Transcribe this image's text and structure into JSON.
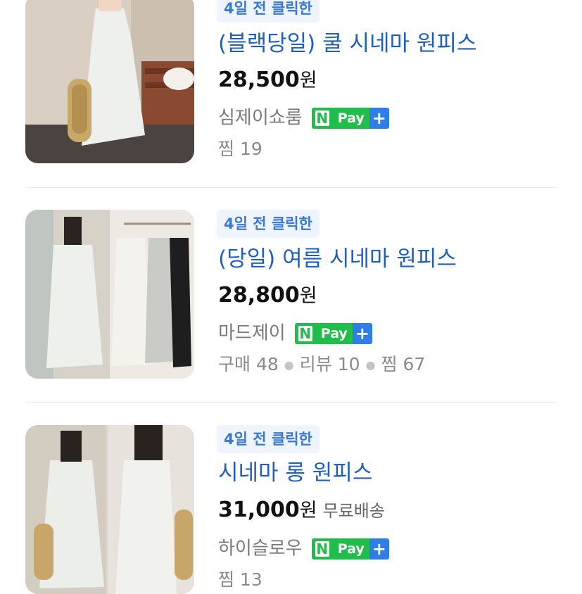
{
  "items": [
    {
      "badge": "4일 전 클릭한",
      "title": "(블랙당일) 쿨 시네마 원피스",
      "price": "28,500",
      "currency": "원",
      "store": "심제이쇼룸",
      "stats": {
        "zzim_label": "찜",
        "zzim": "19"
      }
    },
    {
      "badge": "4일 전 클릭한",
      "title": "(당일) 여름 시네마 원피스",
      "price": "28,800",
      "currency": "원",
      "store": "마드제이",
      "stats": {
        "buy_label": "구매",
        "buy": "48",
        "review_label": "리뷰",
        "review": "10",
        "zzim_label": "찜",
        "zzim": "67"
      }
    },
    {
      "badge": "4일 전 클릭한",
      "title": "시네마 롱 원피스",
      "price": "31,000",
      "currency": "원",
      "shipping": "무료배송",
      "store": "하이슬로우",
      "stats": {
        "zzim_label": "찜",
        "zzim": "13"
      }
    }
  ],
  "npay": {
    "n": "N",
    "pay": "Pay",
    "plus": "+"
  },
  "colors": {
    "title": "#1f5fbf",
    "badge_text": "#3a78d6",
    "badge_bg": "#eef5fe",
    "npay_green": "#1fbe4a",
    "npay_blue": "#2f7de6"
  }
}
